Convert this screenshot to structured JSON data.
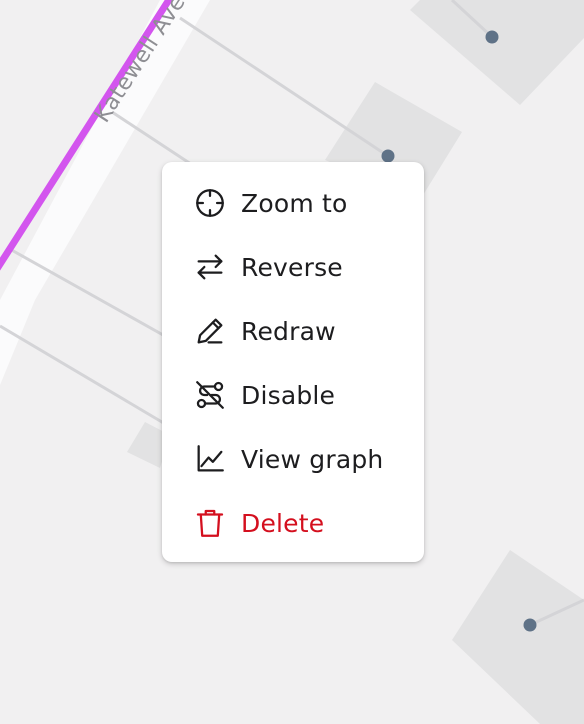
{
  "map": {
    "street_label": "Katewell Ave",
    "route_color": "#d355ee",
    "node_color": "#5f7287"
  },
  "context_menu": {
    "items": [
      {
        "label": "Zoom to",
        "icon": "crosshair-icon",
        "danger": false
      },
      {
        "label": "Reverse",
        "icon": "swap-arrows-icon",
        "danger": false
      },
      {
        "label": "Redraw",
        "icon": "pencil-icon",
        "danger": false
      },
      {
        "label": "Disable",
        "icon": "route-off-icon",
        "danger": false
      },
      {
        "label": "View graph",
        "icon": "line-chart-icon",
        "danger": false
      },
      {
        "label": "Delete",
        "icon": "trash-icon",
        "danger": true
      }
    ],
    "text_color": "#1d1d1f",
    "danger_color": "#d40f1e"
  }
}
